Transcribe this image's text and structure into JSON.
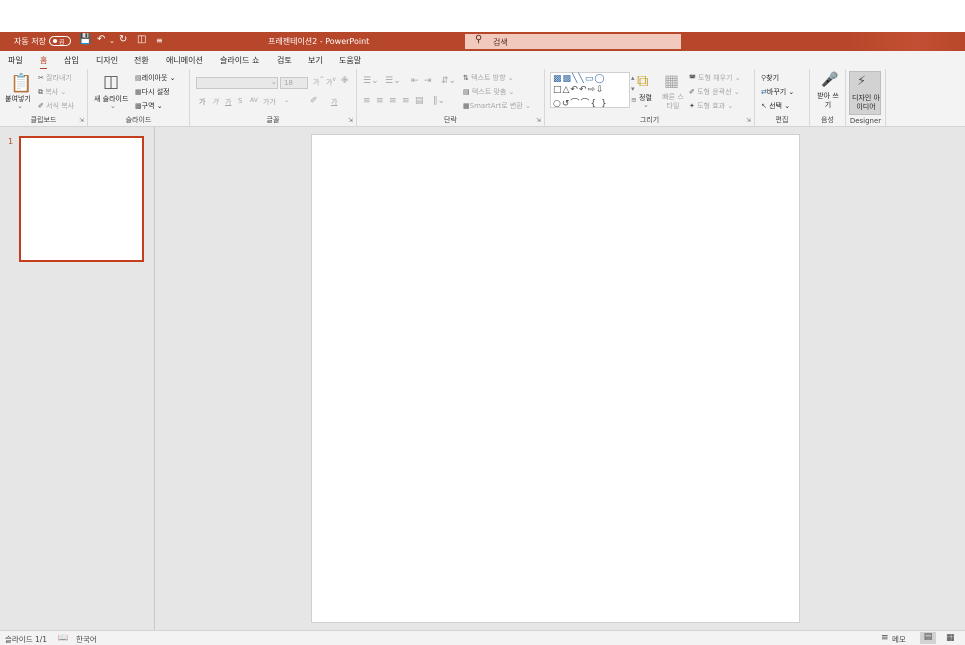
{
  "titlebar": {
    "autosave_label": "자동 저장",
    "toggle_state": "끔",
    "doc_title": "프레젠테이션2  -  PowerPoint",
    "search_placeholder": "검색"
  },
  "tabs": [
    "파일",
    "홈",
    "삽입",
    "디자인",
    "전환",
    "애니메이션",
    "슬라이드 쇼",
    "검토",
    "보기",
    "도움말"
  ],
  "active_tab": "홈",
  "ribbon": {
    "clipboard": {
      "label": "클립보드",
      "paste": "붙여넣기",
      "cut": "잘라내기",
      "copy": "복사",
      "format_painter": "서식 복사"
    },
    "slides": {
      "label": "슬라이드",
      "new_slide": "새 슬라이드",
      "layout": "레이아웃",
      "reset": "다시 설정",
      "section": "구역"
    },
    "font": {
      "label": "글꼴",
      "font_size": "18",
      "bold": "가",
      "italic": "가",
      "underline": "가",
      "strike": "S",
      "spacing": "AV",
      "case": "가가",
      "font_color": "가"
    },
    "paragraph": {
      "label": "단락",
      "text_direction": "텍스트 방향",
      "align_text": "텍스트 맞춤",
      "smartart": "SmartArt로 변환"
    },
    "drawing": {
      "label": "그리기",
      "arrange": "정렬",
      "quick_styles": "빠른 스타일",
      "shape_fill": "도형 채우기",
      "shape_outline": "도형 윤곽선",
      "shape_effects": "도형 효과"
    },
    "editing": {
      "label": "편집",
      "find": "찾기",
      "replace": "바꾸기",
      "select": "선택"
    },
    "voice": {
      "label": "음성",
      "dictate": "받아 쓰기"
    },
    "designer": {
      "label": "Designer",
      "design_ideas": "디자인 아이디어"
    }
  },
  "thumbnails": [
    {
      "number": "1"
    }
  ],
  "status": {
    "slide_count": "슬라이드 1/1",
    "language": "한국어",
    "notes": "메모"
  },
  "colors": {
    "accent": "#b7472a",
    "ribbon_bg": "#f3f3f3",
    "canvas_bg": "#e6e6e6"
  }
}
